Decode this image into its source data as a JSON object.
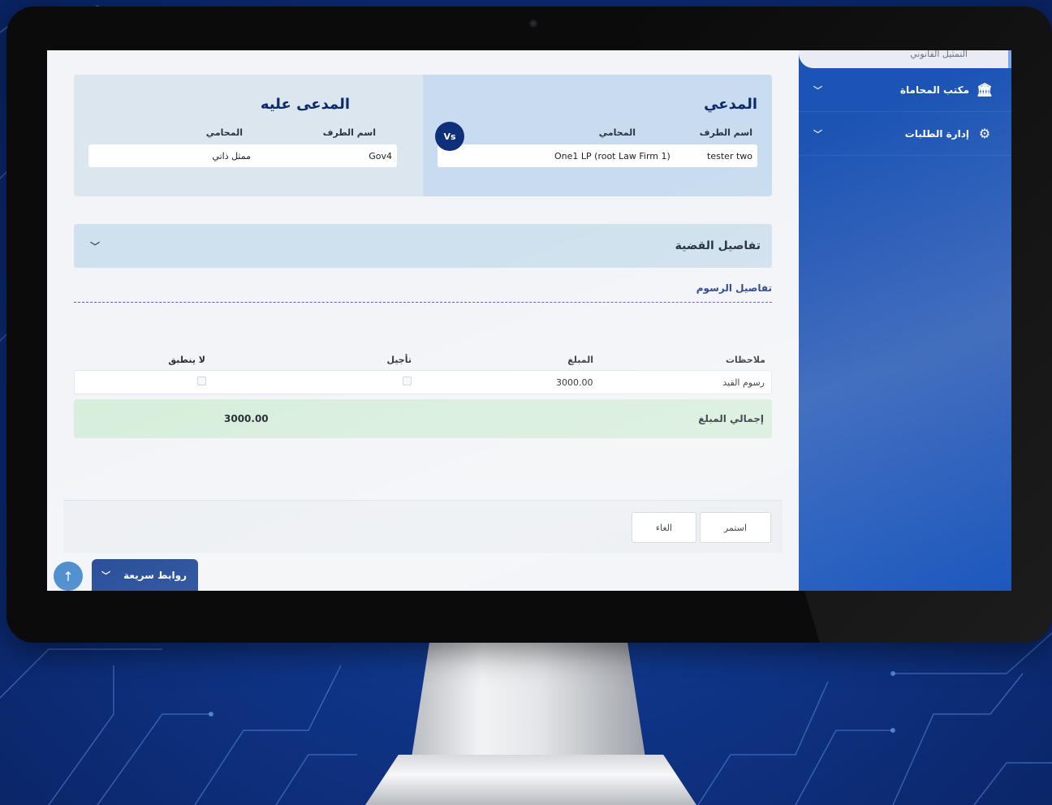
{
  "sidebar": {
    "top_item": "التمثيل القانوني",
    "items": [
      {
        "label": "مكتب المحاماة",
        "icon": "building-icon"
      },
      {
        "label": "إدارة الطلبات",
        "icon": "gears-icon"
      }
    ]
  },
  "parties": {
    "plaintiff": {
      "title": "المدعي",
      "label_party_name": "اسم الطرف",
      "label_lawyer": "المحامي",
      "party_name": "tester two",
      "lawyer": "One1 LP (root Law Firm 1)"
    },
    "vs_label": "Vs",
    "defendant": {
      "title": "المدعى عليه",
      "label_party_name": "اسم الطرف",
      "label_lawyer": "المحامي",
      "party_name": "Gov4",
      "lawyer": "ممثل ذاتي"
    }
  },
  "case_details": {
    "label": "تفاصيل القضية"
  },
  "fees": {
    "title": "تفاصيل الرسوم",
    "columns": {
      "notes": "ملاحظات",
      "amount": "المبلغ",
      "defer": "تأجيل",
      "not_applicable": "لا ينطبق"
    },
    "rows": [
      {
        "notes": "رسوم القيد",
        "amount": "3000.00",
        "defer": false,
        "not_applicable": false
      }
    ],
    "total_label": "إجمالي المبلغ",
    "total_value": "3000.00"
  },
  "actions": {
    "continue_label": "استمر",
    "cancel_label": "الغاء"
  },
  "quick_links": {
    "label": "روابط سريعة"
  },
  "colors": {
    "sidebar": "#1a4fb0",
    "primary_navy": "#0e2f7a",
    "plaintiff_panel": "#c9dcef",
    "defendant_panel": "#dce6ef",
    "total_row": "#d7eedb"
  }
}
